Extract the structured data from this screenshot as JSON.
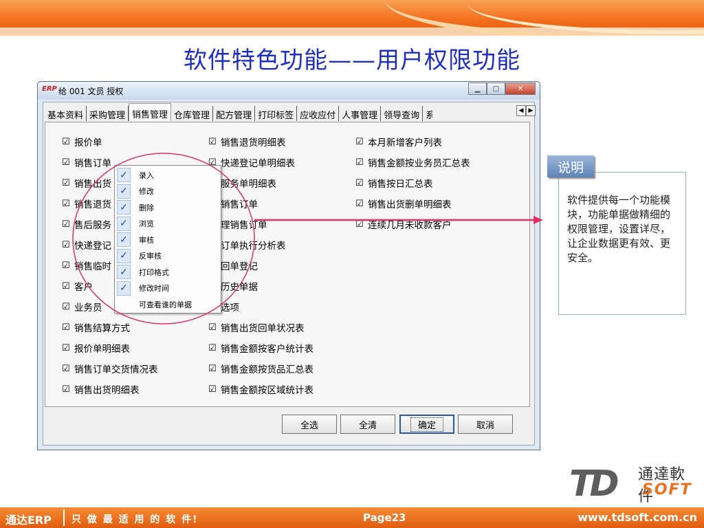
{
  "slide": {
    "title": "软件特色功能——用户权限功能"
  },
  "window": {
    "title": "给 001 文员 授权",
    "app_icon_text": "ERP"
  },
  "tabs": [
    "基本资料",
    "采购管理",
    "销售管理",
    "仓库管理",
    "配方管理",
    "打印标签",
    "应收应付",
    "人事管理",
    "领导查询",
    "系"
  ],
  "active_tab": "销售管理",
  "checkboxes": {
    "col1": [
      "报价单",
      "销售订单",
      "销售出货",
      "销售退货",
      "售后服务",
      "快递登记",
      "销售临时",
      "客户",
      "业务员",
      "销售结算方式",
      "报价单明细表",
      "销售订单交货情况表",
      "销售出货明细表"
    ],
    "col2": [
      "销售退货明细表",
      "快递登记单明细表",
      "服务单明细表",
      "销售订单",
      "理销售订单",
      "订单执行分析表",
      "回单登记",
      "历史单据",
      "选项",
      "销售出货回单状况表",
      "销售金额按客户统计表",
      "销售金额按货品汇总表",
      "销售金额按区域统计表"
    ],
    "col3": [
      "本月新增客户列表",
      "销售金额按业务员汇总表",
      "销售按日汇总表",
      "销售出货删单明细表",
      "连续几月未收款客户"
    ]
  },
  "popup_menu": [
    {
      "label": "录入",
      "checked": true
    },
    {
      "label": "修改",
      "checked": true
    },
    {
      "label": "删除",
      "checked": true
    },
    {
      "label": "浏览",
      "checked": true
    },
    {
      "label": "审核",
      "checked": true
    },
    {
      "label": "反审核",
      "checked": true
    },
    {
      "label": "打印格式",
      "checked": true
    },
    {
      "label": "修改时间",
      "checked": true
    },
    {
      "label": "可查看谁的单据",
      "checked": false
    }
  ],
  "buttons": {
    "select_all": "全选",
    "clear_all": "全清",
    "ok": "确定",
    "cancel": "取消"
  },
  "note": {
    "tag": "说明",
    "text": "软件提供每一个功能模块，功能单据做精细的权限管理，设置详尽，让企业数据更有效、更安全。"
  },
  "logo": {
    "mark": "TD",
    "name_cn": "通達軟件",
    "name_en": "SOFT"
  },
  "footer": {
    "brand": "通达ERP",
    "slogan": "只 做 最 适 用 的 软 件!",
    "page": "Page23",
    "url": "www.tdsoft.com.cn"
  },
  "colors": {
    "title_blue": "#1f2ec2",
    "orange": "#f36f1d",
    "ellipse_red": "#e0306a",
    "arrow_pink": "#e0306a"
  }
}
